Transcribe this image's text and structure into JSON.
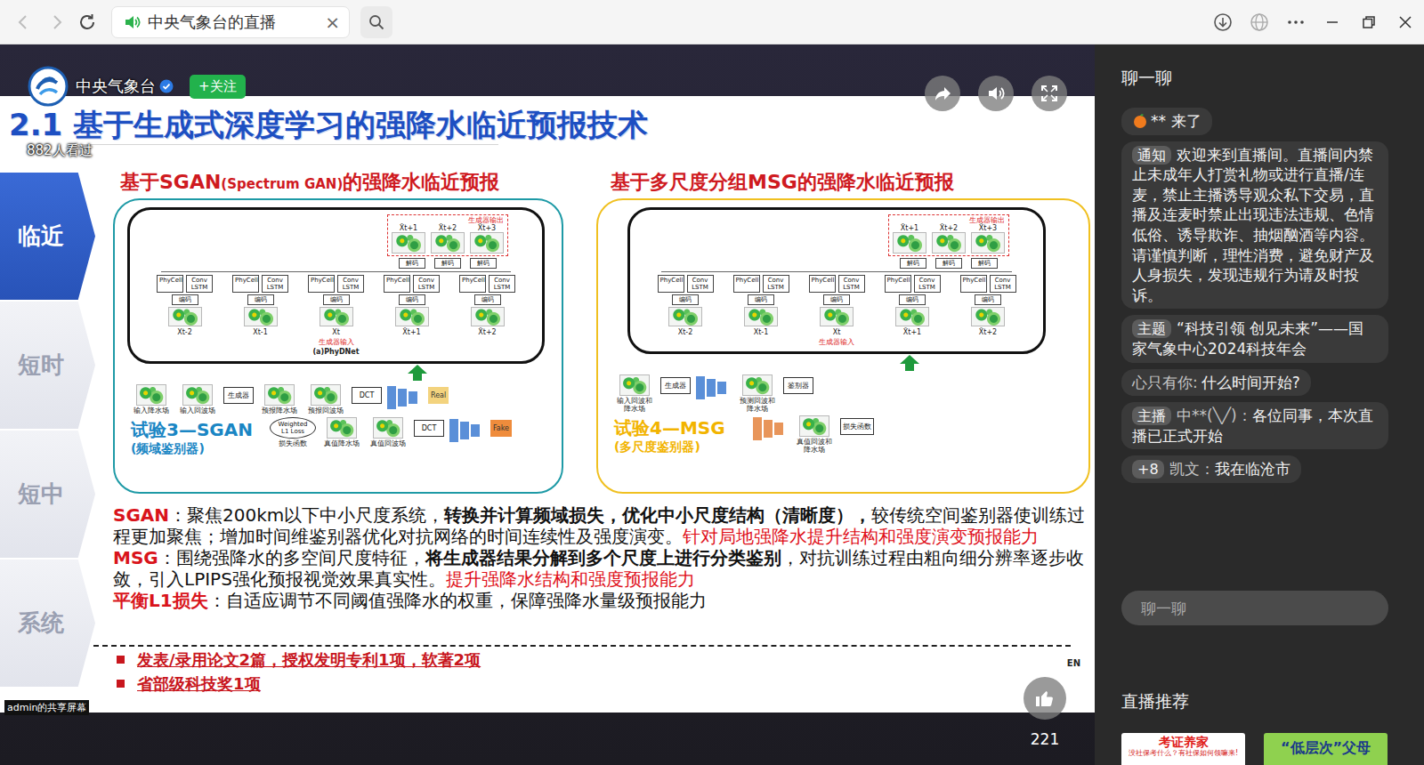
{
  "browser": {
    "tab": {
      "title": "中央气象台的直播",
      "close": "×",
      "playing_audio": true
    }
  },
  "player": {
    "channel": {
      "name": "中央气象台",
      "verified": true,
      "follow": "+关注",
      "views": "882人看过"
    },
    "share_label": "admin的共享屏幕",
    "likes": "221"
  },
  "slide": {
    "title": "2.1 基于生成式深度学习的强降水临近预报技术",
    "nav": [
      {
        "label": "临近",
        "selected": true
      },
      {
        "label": "短时",
        "selected": false
      },
      {
        "label": "短中",
        "selected": false
      },
      {
        "label": "系统",
        "selected": false
      }
    ],
    "panels": [
      {
        "heading": [
          {
            "text": "基于SGAN",
            "small": false
          },
          {
            "text": "(Spectrum GAN)",
            "small": true
          },
          {
            "text": "的强降水临近预报",
            "small": false
          }
        ],
        "color": "#1e9aa6",
        "generator": {
          "output_label": "生成器输出",
          "outputs": [
            "X̂t+1",
            "X̂t+2",
            "X̂t+3"
          ],
          "decode": "解码",
          "cells": [
            "PhyCell",
            "Conv LSTM"
          ],
          "encode": "编码",
          "inputs": [
            "Xt-2",
            "Xt-1",
            "Xt",
            "X̂t+1",
            "X̂t+2"
          ],
          "input_label": "生成器输入",
          "caption": "(a)PhyDNet"
        },
        "flow": [
          [
            {
              "kind": "map",
              "label": "输入降水场"
            },
            {
              "kind": "map",
              "label": "输入回波场"
            },
            {
              "kind": "box",
              "label": "生成器"
            },
            {
              "kind": "map",
              "label": "预报降水场"
            },
            {
              "kind": "map",
              "label": "预报回波场"
            },
            {
              "kind": "box",
              "label": "DCT"
            },
            {
              "kind": "stack",
              "color": "#5a8fd8"
            },
            {
              "kind": "tag",
              "label": "Real",
              "color": "#f3d37e"
            }
          ],
          [
            {
              "kind": "oval",
              "text": "Weighted L1 Loss",
              "label": "损失函数"
            },
            {
              "kind": "map",
              "label": "真值降水场"
            },
            {
              "kind": "map",
              "label": "真值回波场"
            },
            {
              "kind": "box",
              "label": "DCT"
            },
            {
              "kind": "stack",
              "color": "#5a8fd8"
            },
            {
              "kind": "tag",
              "label": "Fake",
              "color": "#ef8c3c"
            }
          ]
        ],
        "experiment": {
          "title": "试验3—SGAN",
          "sub": "(频域鉴别器)",
          "color": "#1a86c4"
        }
      },
      {
        "heading": [
          {
            "text": "基于多尺度分组MSG的强降水临近预报",
            "small": false
          }
        ],
        "color": "#f0c020",
        "generator": {
          "output_label": "生成器输出",
          "outputs": [
            "X̂t+1",
            "X̂t+2",
            "X̂t+3"
          ],
          "decode": "解码",
          "cells": [
            "PhyCell",
            "Conv LSTM"
          ],
          "encode": "编码",
          "inputs": [
            "Xt-2",
            "Xt-1",
            "Xt",
            "X̂t+1",
            "X̂t+2"
          ],
          "input_label": "生成器输入"
        },
        "flow": [
          [
            {
              "kind": "map",
              "label": "输入回波和降水场"
            },
            {
              "kind": "box",
              "label": "生成器"
            },
            {
              "kind": "stack",
              "color": "#5a8fd8"
            },
            {
              "kind": "map",
              "label": "预测回波和降水场"
            },
            {
              "kind": "box",
              "label": "鉴别器"
            }
          ],
          [
            {
              "kind": "stack",
              "color": "#e8955a"
            },
            {
              "kind": "map",
              "label": "真值回波和降水场"
            },
            {
              "kind": "box",
              "label": "损失函数"
            }
          ]
        ],
        "experiment": {
          "title": "试验4—MSG",
          "sub": "(多尺度鉴别器)",
          "color": "#f2b400"
        }
      }
    ],
    "paragraphs": [
      [
        {
          "text": "SGAN",
          "kind": "label"
        },
        {
          "text": "：聚焦200km以下中小尺度系统，",
          "kind": "normal"
        },
        {
          "text": "转换并计算频域损失，优化中小尺度结构（清晰度），",
          "kind": "bold"
        },
        {
          "text": "较传统空间鉴别器使训练过程更加聚焦；增加时间维鉴别器优化对抗网络的时间连续性及强度演变。",
          "kind": "normal"
        },
        {
          "text": "针对局地强降水提升结构和强度演变预报能力",
          "kind": "red"
        }
      ],
      [
        {
          "text": "MSG",
          "kind": "label"
        },
        {
          "text": "：围绕强降水的多空间尺度特征，",
          "kind": "normal"
        },
        {
          "text": "将生成器结果分解到多个尺度上进行分类鉴别",
          "kind": "bold"
        },
        {
          "text": "，对抗训练过程由粗向细分辨率逐步收敛，引入LPIPS强化预报视觉效果真实性。",
          "kind": "normal"
        },
        {
          "text": "提升强降水结构和强度预报能力",
          "kind": "red"
        }
      ],
      [
        {
          "text": "平衡L1损失",
          "kind": "label"
        },
        {
          "text": "：自适应调节不同阈值强降水的权重，保障强降水量级预报能力",
          "kind": "normal"
        }
      ]
    ],
    "bullets": [
      "发表/录用论文2篇，授权发明专利1项，软著2项",
      "省部级科技奖1项"
    ],
    "lang": "EN"
  },
  "chat": {
    "title": "聊一聊",
    "messages": [
      {
        "kind": "join",
        "user": "**",
        "text": "来了"
      },
      {
        "kind": "badge",
        "badge": "通知",
        "text": "欢迎来到直播间。直播间内禁止未成年人打赏礼物或进行直播/连麦，禁止主播诱导观众私下交易，直播及连麦时禁止出现违法违规、色情低俗、诱导欺诈、抽烟酗酒等内容。请谨慎判断，理性消费，避免财产及人身损失，发现违规行为请及时投诉。"
      },
      {
        "kind": "badge",
        "badge": "主题",
        "text": "“科技引领 创见未来”——国家气象中心2024科技年会"
      },
      {
        "kind": "message",
        "user": "心只有你:",
        "text": "什么时间开始?"
      },
      {
        "kind": "badge",
        "badge": "主播",
        "user": "中**(╲╱)：",
        "text": "各位同事，本次直播已正式开始"
      },
      {
        "kind": "badge",
        "badge": "+8",
        "user": "凯文：",
        "text": "我在临沧市"
      }
    ],
    "input": {
      "placeholder": "聊一聊"
    }
  },
  "recommend": {
    "title": "直播推荐",
    "cards": [
      {
        "title": "考证养家",
        "sub": "没社保考什么？有社保如何领嘛来!",
        "color": "#ffffff"
      },
      {
        "title": "“低层次”父母",
        "color": "#8fd14f"
      }
    ]
  }
}
